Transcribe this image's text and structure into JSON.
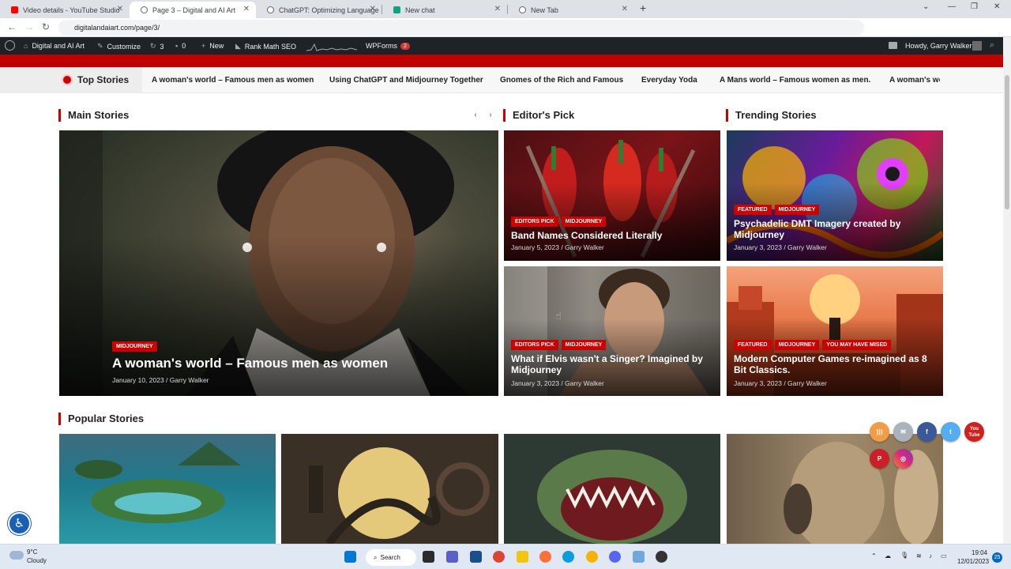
{
  "browser": {
    "tabs": [
      {
        "title": "Video details - YouTube Studio",
        "color": "#ff0000"
      },
      {
        "title": "Page 3 – Digital and AI Art",
        "color": "#5f6368"
      },
      {
        "title": "ChatGPT: Optimizing Language",
        "color": "#5f6368"
      },
      {
        "title": "New chat",
        "color": "#10a37f"
      },
      {
        "title": "New Tab",
        "color": "#5f6368"
      }
    ],
    "new_tab_icon": "+",
    "url": "digitalandaiart.com/page/3/"
  },
  "wp_admin": {
    "site_name": "Digital and AI Art",
    "customize": "Customize",
    "updates_count": "3",
    "comments_count": "0",
    "new_label": "New",
    "seo_label": "Rank Math SEO",
    "wpforms_label": "WPForms",
    "wpforms_badge": "2",
    "howdy": "Howdy, Garry Walker"
  },
  "top_stories": {
    "label": "Top Stories",
    "items": [
      "A woman's world – Famous men as women",
      "Using ChatGPT and Midjourney Together",
      "Gnomes of the Rich and Famous",
      "Everyday Yoda",
      "A Mans world – Famous women as men.",
      "A woman's world – Famous men as women"
    ]
  },
  "sections": {
    "main": "Main Stories",
    "editors": "Editor's Pick",
    "trending": "Trending Stories",
    "popular": "Popular Stories"
  },
  "main_story": {
    "tags": [
      "MIDJOURNEY"
    ],
    "title": "A woman's world – Famous men as women",
    "meta": "January 10, 2023 / Garry Walker"
  },
  "editors_pick": [
    {
      "tags": [
        "EDITORS PICK",
        "MIDJOURNEY"
      ],
      "title": "Band Names Considered Literally",
      "meta": "January 5, 2023 / Garry Walker"
    },
    {
      "tags": [
        "EDITORS PICK",
        "MIDJOURNEY"
      ],
      "title": "What if Elvis wasn't a Singer? Imagined by Midjourney",
      "meta": "January 3, 2023 / Garry Walker"
    }
  ],
  "trending": [
    {
      "tags": [
        "FEATURED",
        "MIDJOURNEY"
      ],
      "title": "Psychadelic DMT Imagery created by Midjourney",
      "meta": "January 3, 2023 / Garry Walker"
    },
    {
      "tags": [
        "FEATURED",
        "MIDJOURNEY",
        "YOU MAY HAVE MISED"
      ],
      "title": "Modern Computer Games re-imagined as 8 Bit Classics.",
      "meta": "January 3, 2023 / Garry Walker"
    }
  ],
  "social": {
    "youtube": "You Tube"
  },
  "taskbar": {
    "weather_temp": "9°C",
    "weather_desc": "Cloudy",
    "search": "Search",
    "time": "19:04",
    "date": "12/01/2023",
    "notif": "25"
  }
}
